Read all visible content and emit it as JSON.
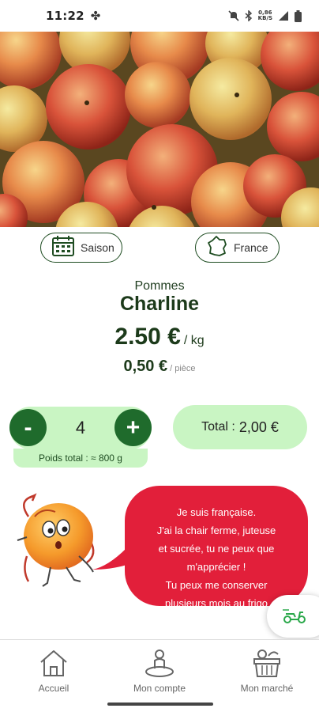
{
  "status_bar": {
    "time": "11:22",
    "left_icon": "fan-icon",
    "net_speed_top": "0,86",
    "net_speed_bottom": "KB/S",
    "icons": [
      "mute-icon",
      "bluetooth-icon",
      "signal-icon",
      "battery-icon"
    ]
  },
  "hero": {
    "image": "apples-photo"
  },
  "chips": {
    "season": {
      "label": "Saison",
      "icon": "calendar-icon"
    },
    "origin": {
      "label": "France",
      "icon": "france-map-icon"
    }
  },
  "product": {
    "category": "Pommes",
    "name": "Charline",
    "price": "2.50 €",
    "price_unit": "/ kg",
    "price_piece": "0,50 €",
    "price_piece_unit": "/ pièce"
  },
  "quantity": {
    "minus_label": "-",
    "plus_label": "+",
    "value": "4",
    "weight_label": "Poids total : ≈ 800 g"
  },
  "total": {
    "label": "Total :",
    "value": "2,00 €"
  },
  "mascot": {
    "icon": "peach-mascot-icon",
    "speech_lines": [
      "Je suis française.",
      "J'ai la chair ferme, juteuse",
      "et sucrée, tu ne peux que",
      "m'apprécier !",
      "Tu peux me conserver",
      "plusieurs mois au frigo"
    ]
  },
  "fab": {
    "icon": "delivery-scooter-icon"
  },
  "nav": {
    "items": [
      {
        "label": "Accueil",
        "icon": "home-icon"
      },
      {
        "label": "Mon compte",
        "icon": "account-icon"
      },
      {
        "label": "Mon marché",
        "icon": "market-basket-icon"
      }
    ]
  },
  "colors": {
    "dark_green": "#1f6b2c",
    "light_green": "#c9f5c3",
    "text_green": "#1c3a1a",
    "bubble_red": "#e21f3a"
  }
}
